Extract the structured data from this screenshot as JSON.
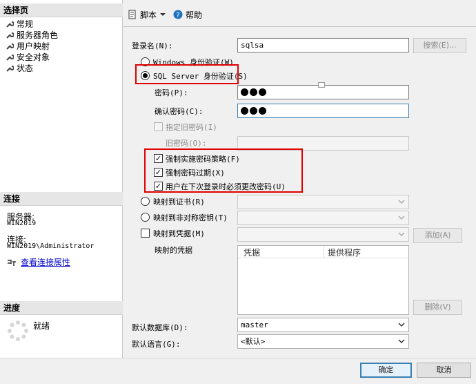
{
  "left": {
    "select_page": "选择页",
    "pages": [
      "常规",
      "服务器角色",
      "用户映射",
      "安全对象",
      "状态"
    ],
    "connection_header": "连接",
    "server_label": "服务器:",
    "server_value": "WIN2019",
    "connection_label": "连接:",
    "connection_value": "WIN2019\\Administrator",
    "view_connection_link": "查看连接属性",
    "progress_header": "进度",
    "progress_status": "就绪"
  },
  "toolbar": {
    "script_label": "脚本",
    "help_label": "帮助"
  },
  "form": {
    "login_name_label": "登录名(N):",
    "login_name_value": "sqlsa",
    "search_button": "搜索(E)...",
    "windows_auth": "Windows 身份验证(W)",
    "sql_auth": "SQL Server 身份验证(S)",
    "password_label": "密码(P):",
    "confirm_label": "确认密码(C):",
    "old_password_check": "指定旧密码(I)",
    "old_password_label": "旧密码(O):",
    "enforce_policy": "强制实施密码策略(F)",
    "enforce_expiration": "强制密码过期(X)",
    "must_change": "用户在下次登录时必须更改密码(U)",
    "map_cert": "映射到证书(R)",
    "map_asym_key": "映射到非对称密钥(T)",
    "map_credential": "映射到凭据(M)",
    "add_button": "添加(A)",
    "mapped_credentials_label": "映射的凭据",
    "grid_col_credential": "凭据",
    "grid_col_provider": "提供程序",
    "remove_button": "删除(V)",
    "default_db_label": "默认数据库(D):",
    "default_db_value": "master",
    "default_lang_label": "默认语言(G):",
    "default_lang_value": "<默认>"
  },
  "footer": {
    "ok_button": "确定",
    "cancel_button": "取消"
  }
}
